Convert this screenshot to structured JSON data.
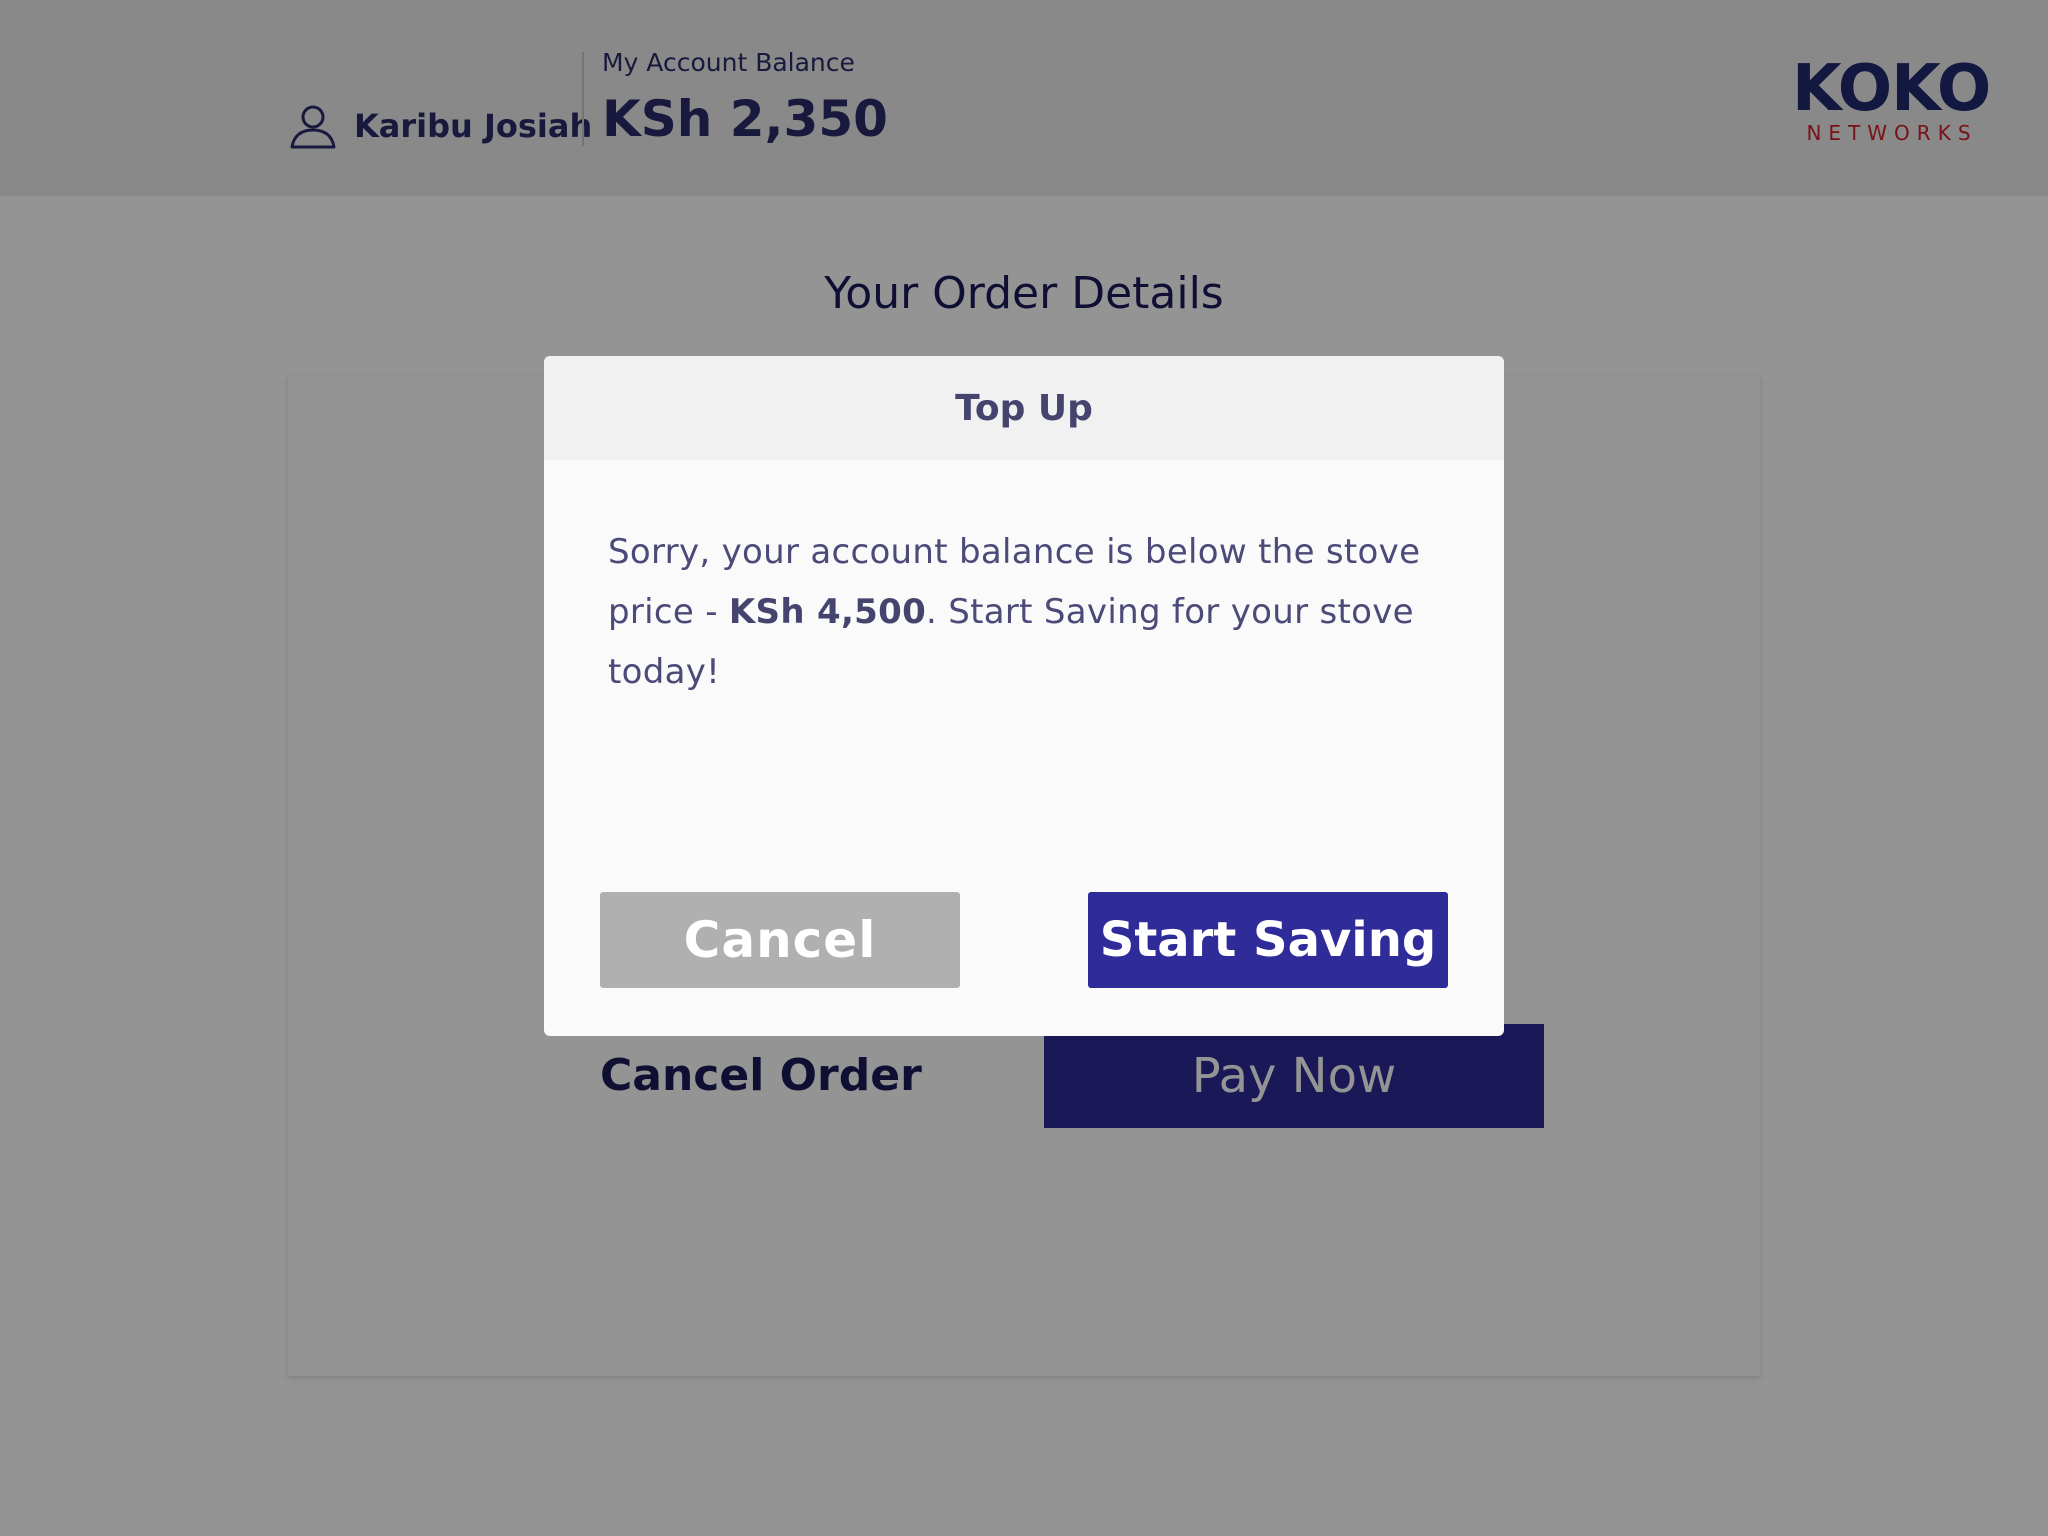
{
  "header": {
    "user_name": "Karibu Josiah",
    "balance_label": "My Account Balance",
    "balance_value": "KSh 2,350",
    "logo_main": "KOKO",
    "logo_sub": "NETWORKS"
  },
  "main": {
    "title": "Your Order Details",
    "cancel_order_label": "Cancel Order",
    "pay_now_label": "Pay Now"
  },
  "modal": {
    "title": "Top Up",
    "message_part1": "Sorry, your account balance is below the stove price - ",
    "message_price": "KSh 4,500",
    "message_part2": ". Start Saving for your stove today!",
    "cancel_label": "Cancel",
    "start_saving_label": "Start Saving"
  },
  "colors": {
    "brand_navy": "#1b1a5a",
    "primary_button": "#2f2c9a",
    "logo_red": "#d0202a",
    "cancel_button": "#b0b0b0"
  },
  "icons": {
    "user": "user-outline-icon"
  }
}
